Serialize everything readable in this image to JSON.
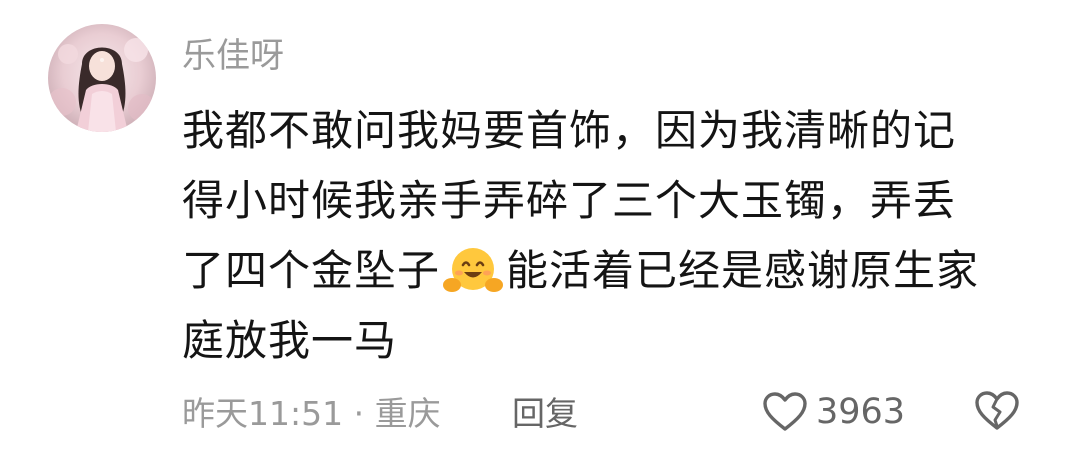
{
  "comment": {
    "username": "乐佳呀",
    "content_lines": [
      "我都不敢问我妈要首饰，因为我清晰的记",
      "得小时候我亲手弄碎了三个大玉镯，弄丢",
      "了四个金坠子",
      "能活着已经是感谢原生家",
      "庭放我一马"
    ],
    "emoji_icon": "hugging-face-emoji",
    "time": "昨天11:51",
    "separator": "·",
    "location": "重庆",
    "reply_label": "回复",
    "like_count": "3963",
    "like_icon": "heart-outline-icon",
    "dislike_icon": "broken-heart-icon"
  },
  "colors": {
    "username": "#9a9a9a",
    "text": "#141414",
    "meta": "#9a9a9a",
    "action": "#666666",
    "emoji": "#ffc83d"
  }
}
